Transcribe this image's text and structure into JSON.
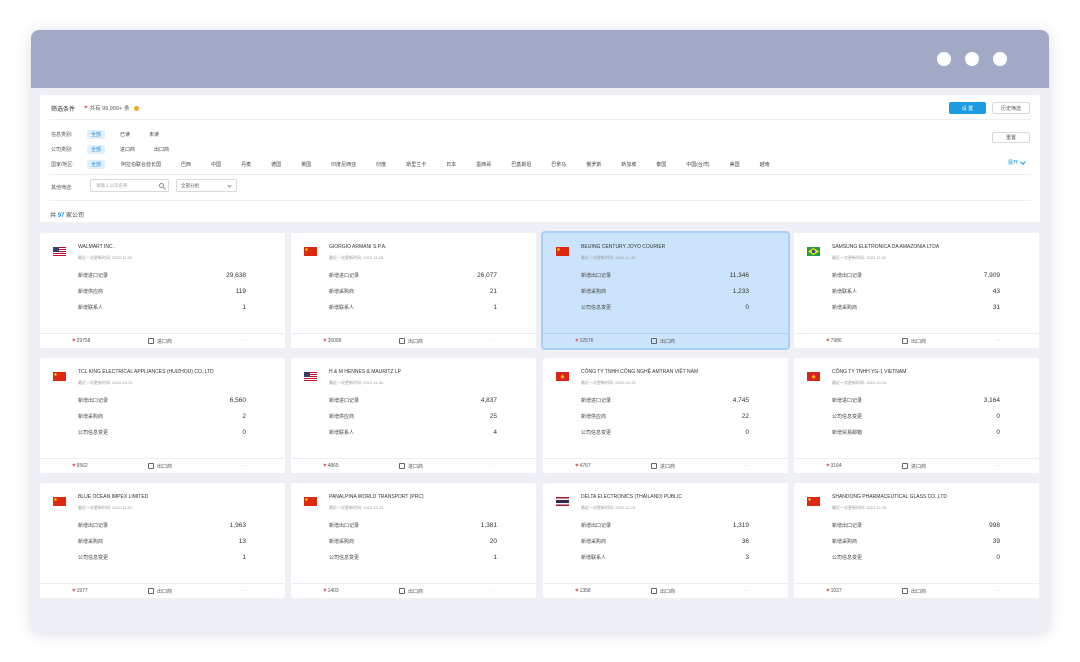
{
  "filter": {
    "title": "筛选条件",
    "count_label": "共有 99,999+",
    "unit": "条",
    "set_button": "设 置",
    "history_button": "历史筛选",
    "reset_button": "重置",
    "rows": [
      {
        "label": "信息类别:",
        "options": [
          "全部",
          "已读",
          "未读"
        ],
        "active": 0
      },
      {
        "label": "公司类别:",
        "options": [
          "全部",
          "进口商",
          "出口商"
        ],
        "active": 0
      }
    ],
    "region": {
      "label": "国家/地区:",
      "options": [
        "全部",
        "阿拉伯联合酋长国",
        "巴西",
        "中国",
        "丹麦",
        "德国",
        "英国",
        "印度尼西亚",
        "印度",
        "斯里兰卡",
        "日本",
        "墨西哥",
        "巴基斯坦",
        "巴拿马",
        "俄罗斯",
        "新加坡",
        "泰国",
        "中国(台湾)",
        "美国",
        "越南"
      ],
      "active": 0
    },
    "expand_label": "展开",
    "search_label": "其他筛选:",
    "search_placeholder": "请输入公司名称",
    "select_value": "全部分组",
    "total_prefix": "共",
    "total_count": "97",
    "total_suffix": "家公司"
  },
  "colors": {
    "accent": "#1d9be0",
    "selected_card": "#cce4fb",
    "titlebar": "#a1a9c6"
  },
  "cards": [
    {
      "name": "WALMART INC .",
      "date": "最近一次更新时间: 2022-11-30",
      "flag": "us-flag",
      "rows": [
        {
          "label": "新增进口记录",
          "value": "29,638"
        },
        {
          "label": "新增供应商",
          "value": "119"
        },
        {
          "label": "新增联系人",
          "value": "1"
        }
      ],
      "footer": {
        "count": "29758",
        "type": "进口商",
        "more": "···"
      },
      "selected": false
    },
    {
      "name": "GIORGIO ARMANI S.P.A.",
      "date": "最近一次更新时间: 2022-11-28",
      "flag": "cn-flag",
      "rows": [
        {
          "label": "新增进口记录",
          "value": "26,077"
        },
        {
          "label": "新增采购商",
          "value": "21"
        },
        {
          "label": "新增联系人",
          "value": "1"
        }
      ],
      "footer": {
        "count": "26099",
        "type": "出口商",
        "more": "···"
      },
      "selected": false
    },
    {
      "name": "BEIJING CENTURY JOYO COURIER",
      "date": "最近一次更新时间: 2022-11-30",
      "flag": "cn-flag",
      "rows": [
        {
          "label": "新增出口记录",
          "value": "11,346"
        },
        {
          "label": "新增采购商",
          "value": "1,233"
        },
        {
          "label": "公司信息变更",
          "value": "0"
        }
      ],
      "footer": {
        "count": "12576",
        "type": "出口商",
        "more": "···"
      },
      "selected": true
    },
    {
      "name": "SAMSUNG ELETRONICA DA AMAZONIA LTDA",
      "date": "最近一次更新时间: 2022-11-02",
      "flag": "br-flag",
      "rows": [
        {
          "label": "新增出口记录",
          "value": "7,909"
        },
        {
          "label": "新增联系人",
          "value": "43"
        },
        {
          "label": "新增采购商",
          "value": "31"
        }
      ],
      "footer": {
        "count": "7986",
        "type": "出口商",
        "more": "···"
      },
      "selected": false
    },
    {
      "name": "TCL KING ELECTRICAL APPLIANCES (HUIZHOU) CO.,LTD",
      "date": "最近一次更新时间: 2022-10-31",
      "flag": "cn-flag",
      "rows": [
        {
          "label": "新增出口记录",
          "value": "6,560"
        },
        {
          "label": "新增采购商",
          "value": "2"
        },
        {
          "label": "公司信息变更",
          "value": "0"
        }
      ],
      "footer": {
        "count": "6562",
        "type": "出口商",
        "more": "···"
      },
      "selected": false
    },
    {
      "name": "H & M HENNES & MAURITZ LP",
      "date": "最近一次更新时间: 2022-11-30",
      "flag": "us-flag",
      "rows": [
        {
          "label": "新增进口记录",
          "value": "4,837"
        },
        {
          "label": "新增供应商",
          "value": "25"
        },
        {
          "label": "新增联系人",
          "value": "4"
        }
      ],
      "footer": {
        "count": "4865",
        "type": "进口商",
        "more": "···"
      },
      "selected": false
    },
    {
      "name": "CÔNG TY TNHH CÔNG NGHỆ AMTRAN VIỆT NAM",
      "date": "最近一次更新时间: 2022-10-31",
      "flag": "vn-flag",
      "rows": [
        {
          "label": "新增进口记录",
          "value": "4,745"
        },
        {
          "label": "新增供应商",
          "value": "22"
        },
        {
          "label": "公司信息变更",
          "value": "0"
        }
      ],
      "footer": {
        "count": "4767",
        "type": "进口商",
        "more": "···"
      },
      "selected": false
    },
    {
      "name": "CÔNG TY TNHH YG-1 VIETNAM",
      "date": "最近一次更新时间: 2022-10-31",
      "flag": "vn-flag",
      "rows": [
        {
          "label": "新增进口记录",
          "value": "3,164"
        },
        {
          "label": "公司信息变更",
          "value": "0"
        },
        {
          "label": "新增贸易邮箱",
          "value": "0"
        }
      ],
      "footer": {
        "count": "3164",
        "type": "进口商",
        "more": "···"
      },
      "selected": false
    },
    {
      "name": "BLUE OCEAN IMPEX LIMITED",
      "date": "最近一次更新时间: 2022-11-01",
      "flag": "cn-flag",
      "rows": [
        {
          "label": "新增出口记录",
          "value": "1,963"
        },
        {
          "label": "新增采购商",
          "value": "13"
        },
        {
          "label": "公司信息变更",
          "value": "1"
        }
      ],
      "footer": {
        "count": "1977",
        "type": "出口商",
        "more": "···"
      },
      "selected": false
    },
    {
      "name": "PANALPINA WORLD TRANSPORT (PRC)",
      "date": "最近一次更新时间: 2022-10-31",
      "flag": "cn-flag",
      "rows": [
        {
          "label": "新增出口记录",
          "value": "1,381"
        },
        {
          "label": "新增采购商",
          "value": "20"
        },
        {
          "label": "公司信息变更",
          "value": "1"
        }
      ],
      "footer": {
        "count": "1403",
        "type": "出口商",
        "more": "···"
      },
      "selected": false
    },
    {
      "name": "DELTA ELECTRONICS (THAILAND) PUBLIC",
      "date": "最近一次更新时间: 2022-12-01",
      "flag": "th-flag",
      "rows": [
        {
          "label": "新增出口记录",
          "value": "1,319"
        },
        {
          "label": "新增采购商",
          "value": "36"
        },
        {
          "label": "新增联系人",
          "value": "3"
        }
      ],
      "footer": {
        "count": "1358",
        "type": "出口商",
        "more": "···"
      },
      "selected": false
    },
    {
      "name": "SHANDONG PHARMACEUTICAL GLASS CO.,LTD",
      "date": "最近一次更新时间: 2022-11-15",
      "flag": "cn-flag",
      "rows": [
        {
          "label": "新增出口记录",
          "value": "998"
        },
        {
          "label": "新增采购商",
          "value": "39"
        },
        {
          "label": "公司信息变更",
          "value": "0"
        }
      ],
      "footer": {
        "count": "1037",
        "type": "出口商",
        "more": "···"
      },
      "selected": false
    }
  ]
}
